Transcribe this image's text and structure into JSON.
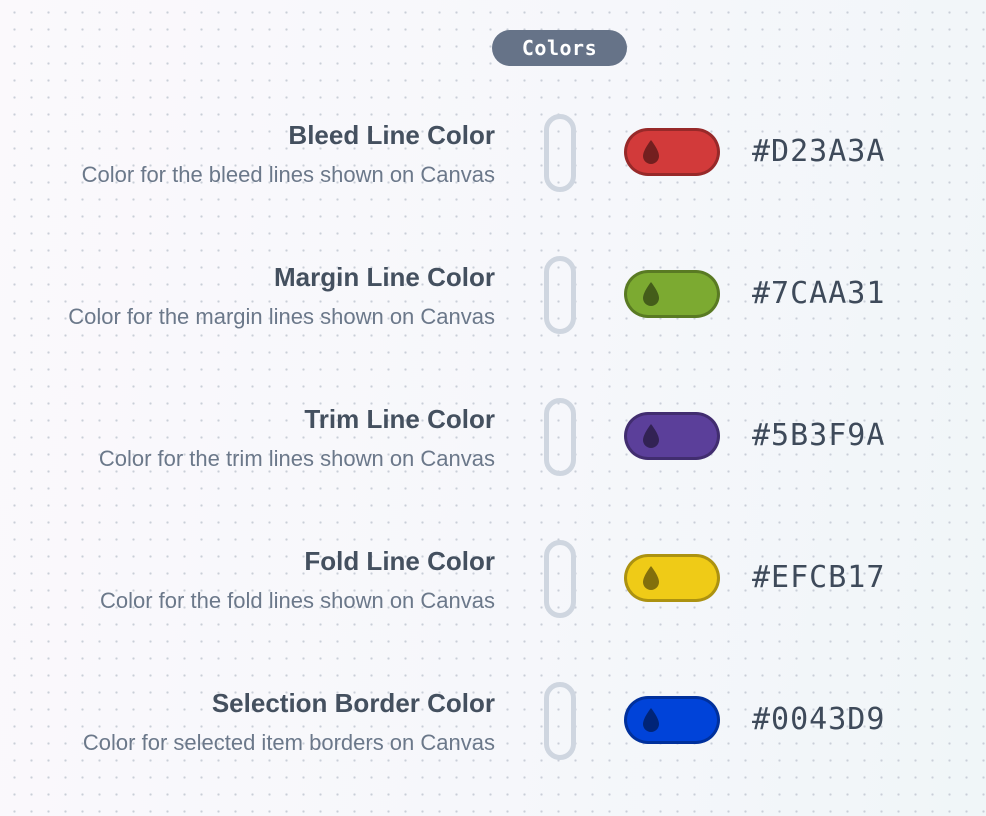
{
  "section": {
    "title": "Colors"
  },
  "colors": [
    {
      "label": "Bleed Line Color",
      "description": "Color for the bleed lines shown on Canvas",
      "value": "#D23A3A",
      "swatch_color": "#D23A3A",
      "icon": "droplet-icon"
    },
    {
      "label": "Margin Line Color",
      "description": "Color for the margin lines shown on Canvas",
      "value": "#7CAA31",
      "swatch_color": "#7CAA31",
      "icon": "droplet-icon"
    },
    {
      "label": "Trim Line Color",
      "description": "Color for the trim lines shown on Canvas",
      "value": "#5B3F9A",
      "swatch_color": "#5B3F9A",
      "icon": "droplet-icon"
    },
    {
      "label": "Fold Line Color",
      "description": "Color for the fold lines shown on Canvas",
      "value": "#EFCB17",
      "swatch_color": "#EFCB17",
      "icon": "droplet-icon"
    },
    {
      "label": "Selection Border Color",
      "description": "Color for selected item borders on Canvas",
      "value": "#0043D9",
      "swatch_color": "#0043D9",
      "icon": "droplet-icon"
    }
  ]
}
